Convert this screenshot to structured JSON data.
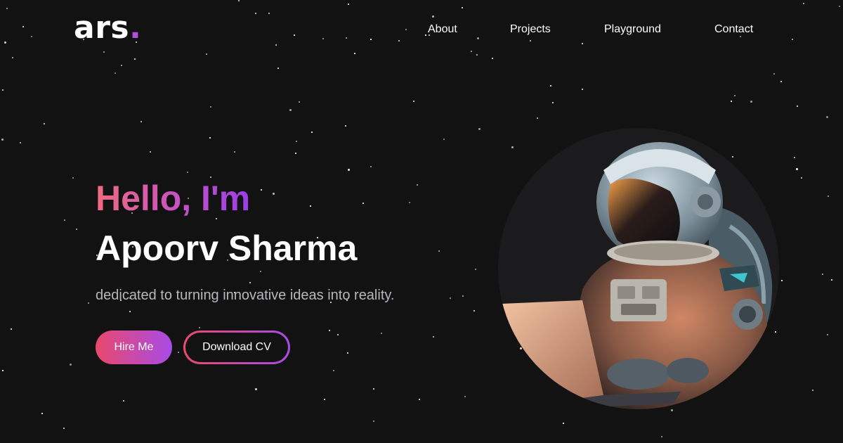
{
  "brand": {
    "logo_text": "ars",
    "logo_dot": ".",
    "accent": "#b04ee0"
  },
  "nav": {
    "items": [
      {
        "label": "About"
      },
      {
        "label": "Projects"
      },
      {
        "label": "Playground"
      },
      {
        "label": "Contact"
      }
    ]
  },
  "hero": {
    "greeting": "Hello, I'm",
    "name": "Apoorv Sharma",
    "tagline": "dedicated to turning innovative ideas into reality.",
    "primary_button": "Hire Me",
    "secondary_button": "Download CV"
  },
  "colors": {
    "background": "#121212",
    "gradient_start": "#e9496c",
    "gradient_end": "#a84be6",
    "tagline": "#b7b7bd"
  },
  "icons": {
    "portrait": "astronaut-illustration"
  }
}
